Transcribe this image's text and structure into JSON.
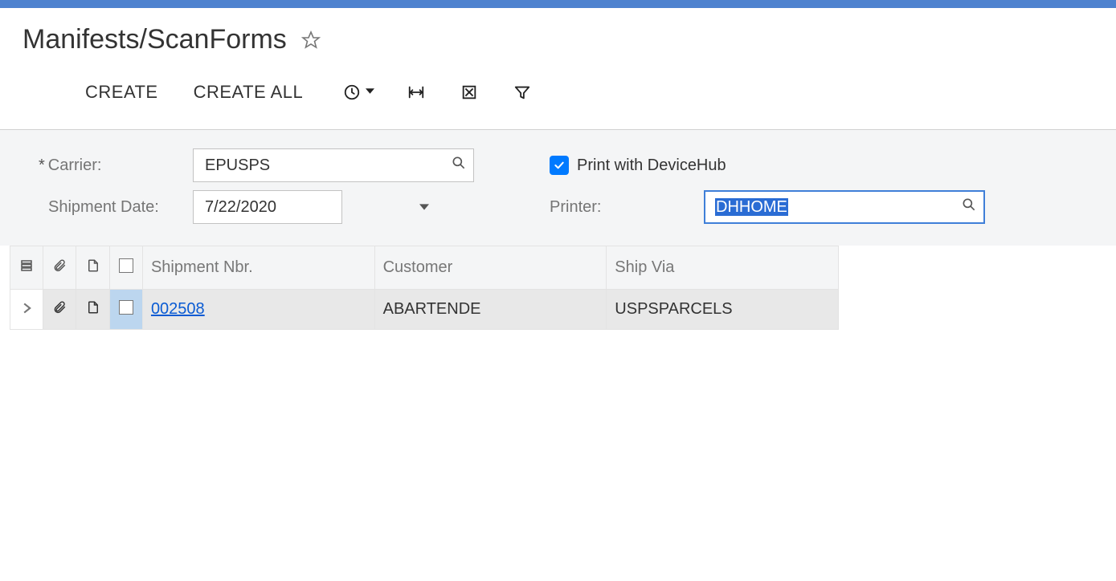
{
  "page": {
    "title": "Manifests/ScanForms"
  },
  "toolbar": {
    "create_label": "CREATE",
    "create_all_label": "CREATE ALL"
  },
  "form": {
    "carrier_label": "Carrier:",
    "carrier_value": "EPUSPS",
    "shipment_date_label": "Shipment Date:",
    "shipment_date_value": "7/22/2020",
    "print_devicehub_label": "Print with DeviceHub",
    "print_devicehub_checked": true,
    "printer_label": "Printer:",
    "printer_value": "DHHOME"
  },
  "grid": {
    "columns": {
      "shipment_nbr": "Shipment Nbr.",
      "customer": "Customer",
      "ship_via": "Ship Via"
    },
    "rows": [
      {
        "shipment_nbr": "002508",
        "customer": "ABARTENDE",
        "ship_via": "USPSPARCELS"
      }
    ]
  }
}
